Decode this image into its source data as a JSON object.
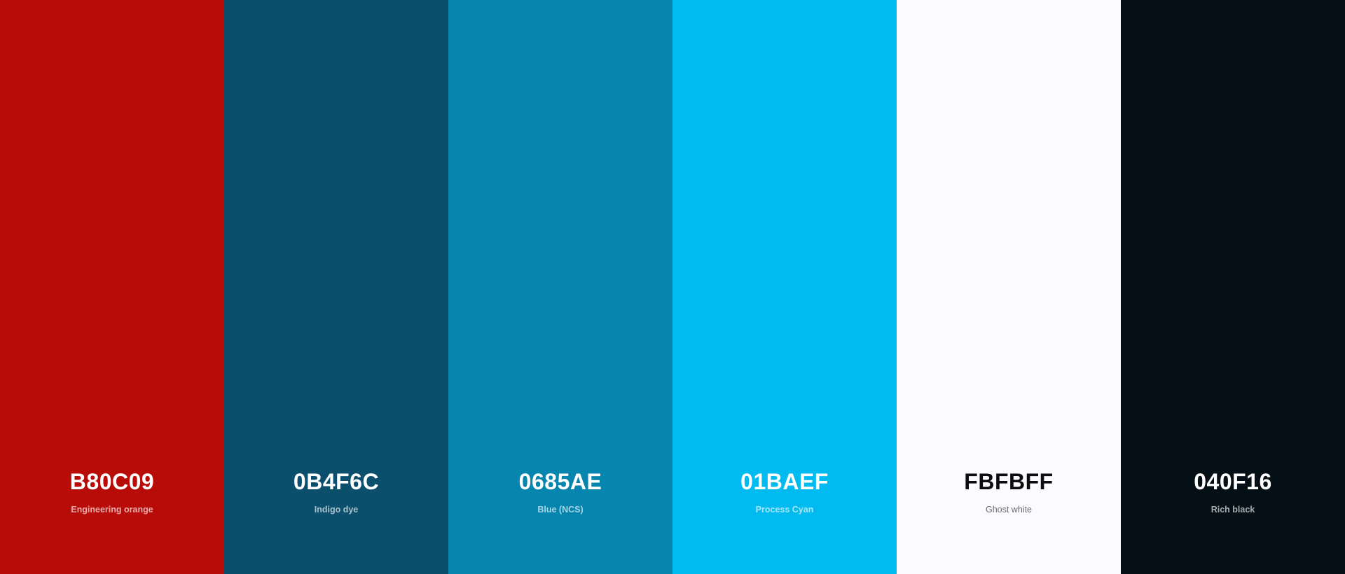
{
  "swatches": [
    {
      "hex": "B80C09",
      "name": "Engineering orange",
      "color": "#B80C09",
      "text_theme": "light"
    },
    {
      "hex": "0B4F6C",
      "name": "Indigo dye",
      "color": "#0B4F6C",
      "text_theme": "light"
    },
    {
      "hex": "0685AE",
      "name": "Blue (NCS)",
      "color": "#0685AE",
      "text_theme": "light"
    },
    {
      "hex": "01BAEF",
      "name": "Process Cyan",
      "color": "#01BAEF",
      "text_theme": "light"
    },
    {
      "hex": "FBFBFF",
      "name": "Ghost white",
      "color": "#FBFBFF",
      "text_theme": "dark"
    },
    {
      "hex": "040F16",
      "name": "Rich black",
      "color": "#040F16",
      "text_theme": "light"
    }
  ]
}
